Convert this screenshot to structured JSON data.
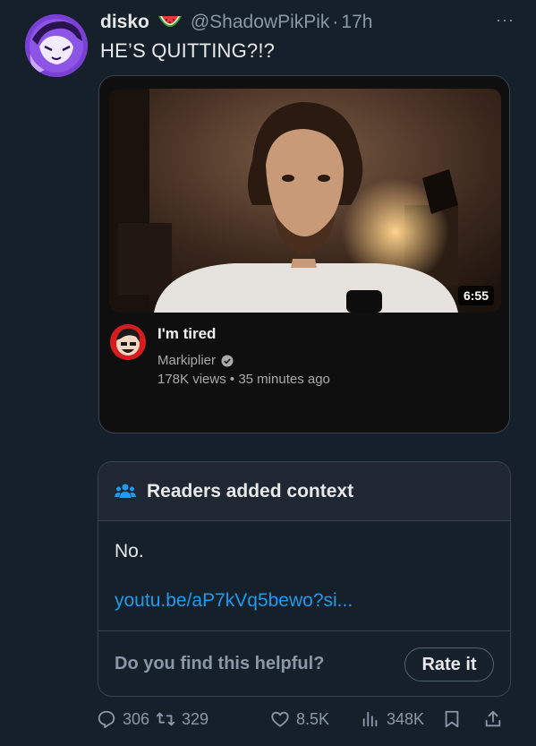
{
  "tweet": {
    "display_name": "disko",
    "handle": "@ShadowPikPik",
    "separator": "·",
    "time": "17h",
    "more": "···",
    "text": "HE’S QUITTING?!?"
  },
  "video_card": {
    "duration": "6:55",
    "title": "I'm tired",
    "channel": "Markiplier",
    "views": "178K views",
    "separator": "•",
    "age": "35 minutes ago"
  },
  "note": {
    "title": "Readers added context",
    "body": "No.",
    "link": "youtu.be/aP7kVq5bewo?si...",
    "helpful_question": "Do you find this helpful?",
    "rate_button": "Rate it"
  },
  "actions": {
    "replies": "306",
    "retweets": "329",
    "likes": "8.5K",
    "views": "348K"
  },
  "colors": {
    "background": "#15202b",
    "text": "#e7e9ea",
    "muted": "#8b98a5",
    "link": "#1d9bf0",
    "note_header": "#1e2732",
    "border": "#38444d"
  },
  "icons": {
    "more": "more-dots-icon",
    "reply": "reply-icon",
    "retweet": "retweet-icon",
    "like": "heart-icon",
    "views": "views-bar-icon",
    "bookmark": "bookmark-icon",
    "share": "share-icon",
    "note": "people-icon",
    "verified": "verified-check-icon",
    "emoji": "watermelon-icon"
  }
}
